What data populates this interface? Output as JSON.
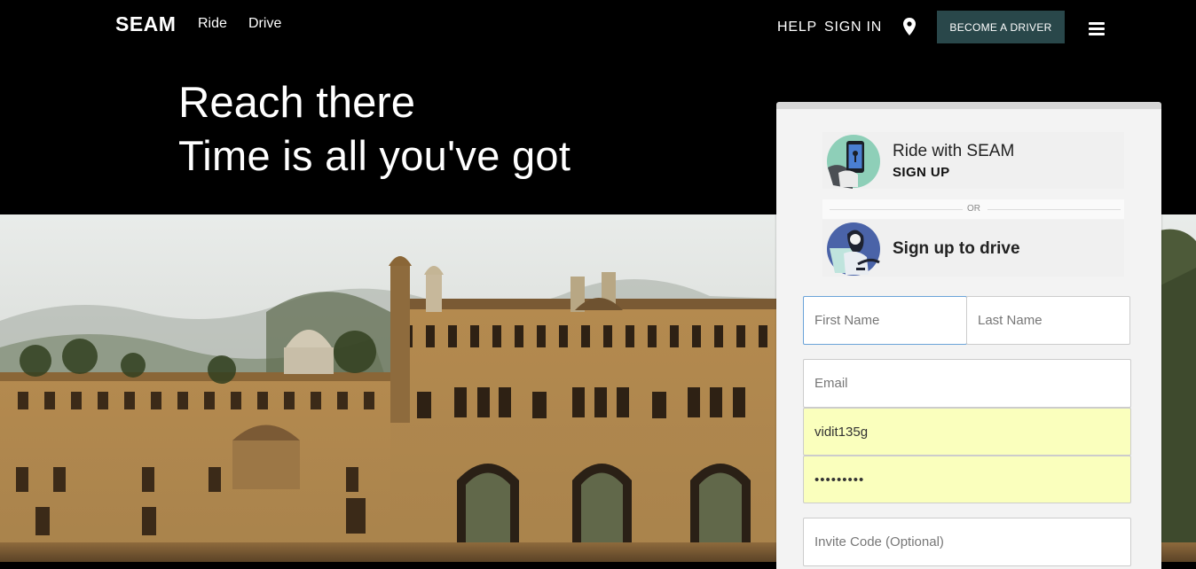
{
  "header": {
    "logo": "SEAM",
    "nav": [
      "Ride",
      "Drive"
    ],
    "help": "HELP",
    "sign_in": "SIGN IN",
    "become_driver": "BECOME A DRIVER"
  },
  "hero": {
    "line1": "Reach there",
    "line2": "Time is all you've got"
  },
  "signup_panel": {
    "ride_title": "Ride with SEAM",
    "ride_sub": "SIGN UP",
    "or": "OR",
    "drive_title": "Sign up to drive",
    "fields": {
      "first_name_placeholder": "First Name",
      "last_name_placeholder": "Last Name",
      "email_placeholder": "Email",
      "username_value": "vidit135g",
      "password_value": "•••••••••",
      "invite_placeholder": "Invite Code (Optional)"
    }
  },
  "colors": {
    "driver_button": "#29474a",
    "autofill": "#faffbd",
    "focus_border": "#6aa3d8"
  }
}
